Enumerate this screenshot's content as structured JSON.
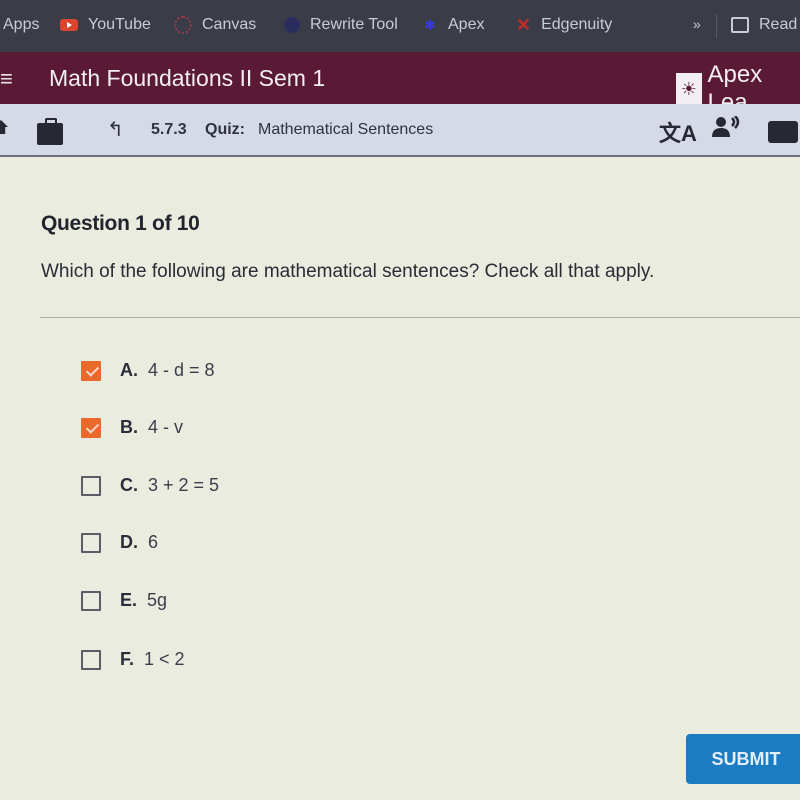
{
  "bookmarks": {
    "items": [
      {
        "label": "Apps",
        "icon": "apps-icon"
      },
      {
        "label": "YouTube",
        "icon": "youtube-icon"
      },
      {
        "label": "Canvas",
        "icon": "canvas-icon"
      },
      {
        "label": "Rewrite Tool",
        "icon": "rewrite-tool-icon"
      },
      {
        "label": "Apex",
        "icon": "apex-icon"
      },
      {
        "label": "Edgenuity",
        "icon": "edgenuity-icon"
      }
    ],
    "overflow": "»",
    "reading_list": "Read"
  },
  "course_header": {
    "menu_icon": "≡",
    "title": "Math Foundations II Sem 1",
    "brand": "Apex Lea"
  },
  "nav": {
    "up_icon": "↰",
    "section_number": "5.7.3",
    "section_type": "Quiz:",
    "section_title": "Mathematical Sentences",
    "translate_icon": "文A",
    "speak_icon": "🗣"
  },
  "question": {
    "header": "Question 1 of 10",
    "prompt": "Which of the following are mathematical sentences? Check all that apply.",
    "options": [
      {
        "letter": "A.",
        "text": "4 - d = 8",
        "checked": true
      },
      {
        "letter": "B.",
        "text": "4 - v",
        "checked": true
      },
      {
        "letter": "C.",
        "text": "3 + 2 = 5",
        "checked": false
      },
      {
        "letter": "D.",
        "text": "6",
        "checked": false
      },
      {
        "letter": "E.",
        "text": "5g",
        "checked": false
      },
      {
        "letter": "F.",
        "text": "1 < 2",
        "checked": false
      }
    ]
  },
  "submit_label": "SUBMIT",
  "colors": {
    "header_bg": "#5a1a35",
    "checkbox_checked": "#e8692b",
    "submit_bg": "#1b7cc1"
  }
}
